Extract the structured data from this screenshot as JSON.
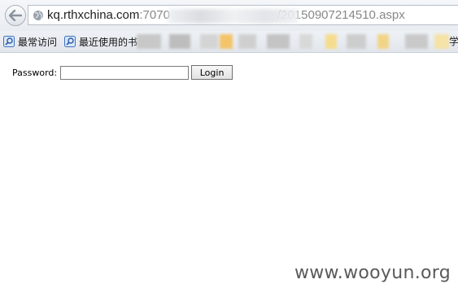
{
  "browser": {
    "url_host": "kq.rthxchina.com",
    "url_port_prefix": ":7070",
    "url_path_end": "/20150907214510.aspx",
    "bookmarks": [
      {
        "label": "最常访问",
        "icon": "bookmark-page-icon"
      },
      {
        "label": "最近使用的书",
        "icon": "bookmark-page-icon"
      }
    ],
    "bookmarks_tail": "学"
  },
  "form": {
    "password_label": "Password:",
    "password_value": "",
    "login_label": "Login"
  },
  "watermark": "www.wooyun.org",
  "colors": {
    "chrome": "#e9edf2",
    "watermark": "#5a5a5a"
  }
}
